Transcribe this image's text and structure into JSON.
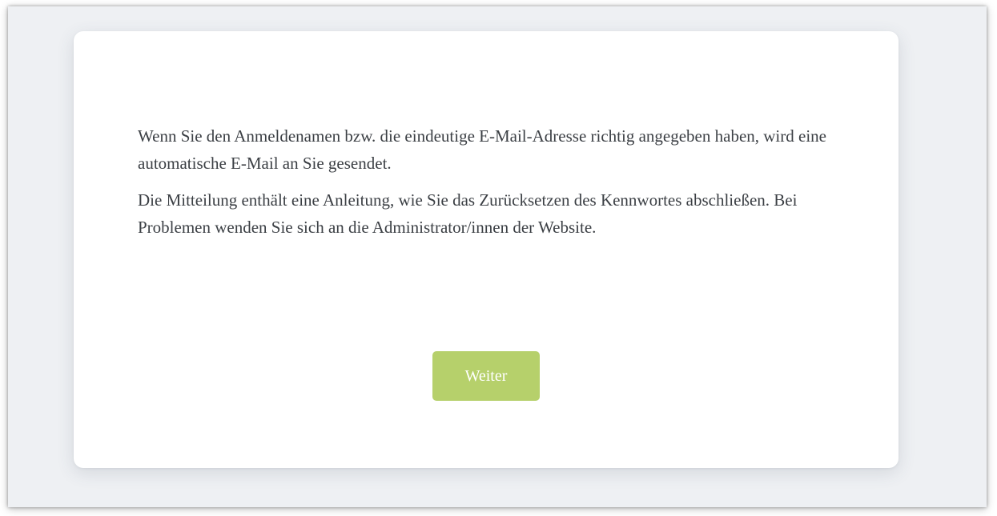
{
  "message": {
    "paragraph_1": "Wenn Sie den Anmeldenamen bzw. die eindeutige E-Mail-Adresse richtig angegeben haben, wird eine automatische E-Mail an Sie gesendet.",
    "paragraph_2": "Die Mitteilung enthält eine Anleitung, wie Sie das Zurücksetzen des Kennwortes abschließen. Bei Problemen wenden Sie sich an die Administrator/innen der Website."
  },
  "actions": {
    "continue_label": "Weiter"
  },
  "colors": {
    "accent": "#b6d06b",
    "page_background": "#eef0f3",
    "card_background": "#ffffff",
    "text": "#3b3f44"
  }
}
